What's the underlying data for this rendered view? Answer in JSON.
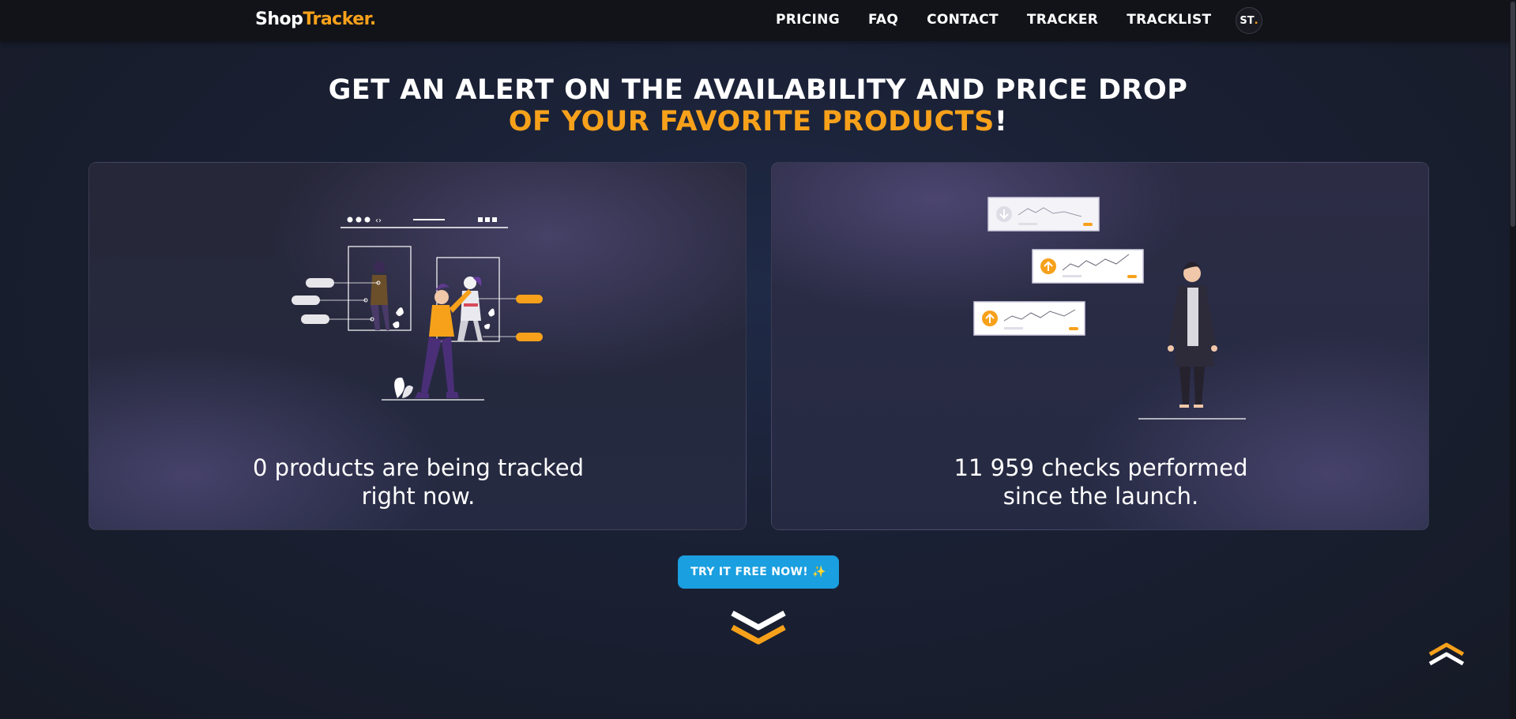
{
  "header": {
    "logo_part1": "Shop",
    "logo_part2": "Tracker.",
    "nav": [
      "PRICING",
      "FAQ",
      "CONTACT",
      "TRACKER",
      "TRACKLIST"
    ],
    "avatar_initials": "ST",
    "avatar_dot": "."
  },
  "hero": {
    "line1": "GET AN ALERT ON THE AVAILABILITY AND PRICE DROP",
    "line2_highlight": "OF YOUR FAVORITE PRODUCTS",
    "line2_end": "!"
  },
  "cards": {
    "left": {
      "line1": "0 products are being tracked",
      "line2": "right now."
    },
    "right": {
      "line1": "11 959 checks performed",
      "line2": "since the launch."
    }
  },
  "cta": {
    "label": "TRY IT FREE NOW! ✨"
  },
  "icons": {
    "scroll_down": "double-chevron-down-icon",
    "back_to_top": "double-chevron-up-icon"
  },
  "colors": {
    "accent": "#f7a11b",
    "cta": "#1a9fe0",
    "navbar": "#121319"
  }
}
